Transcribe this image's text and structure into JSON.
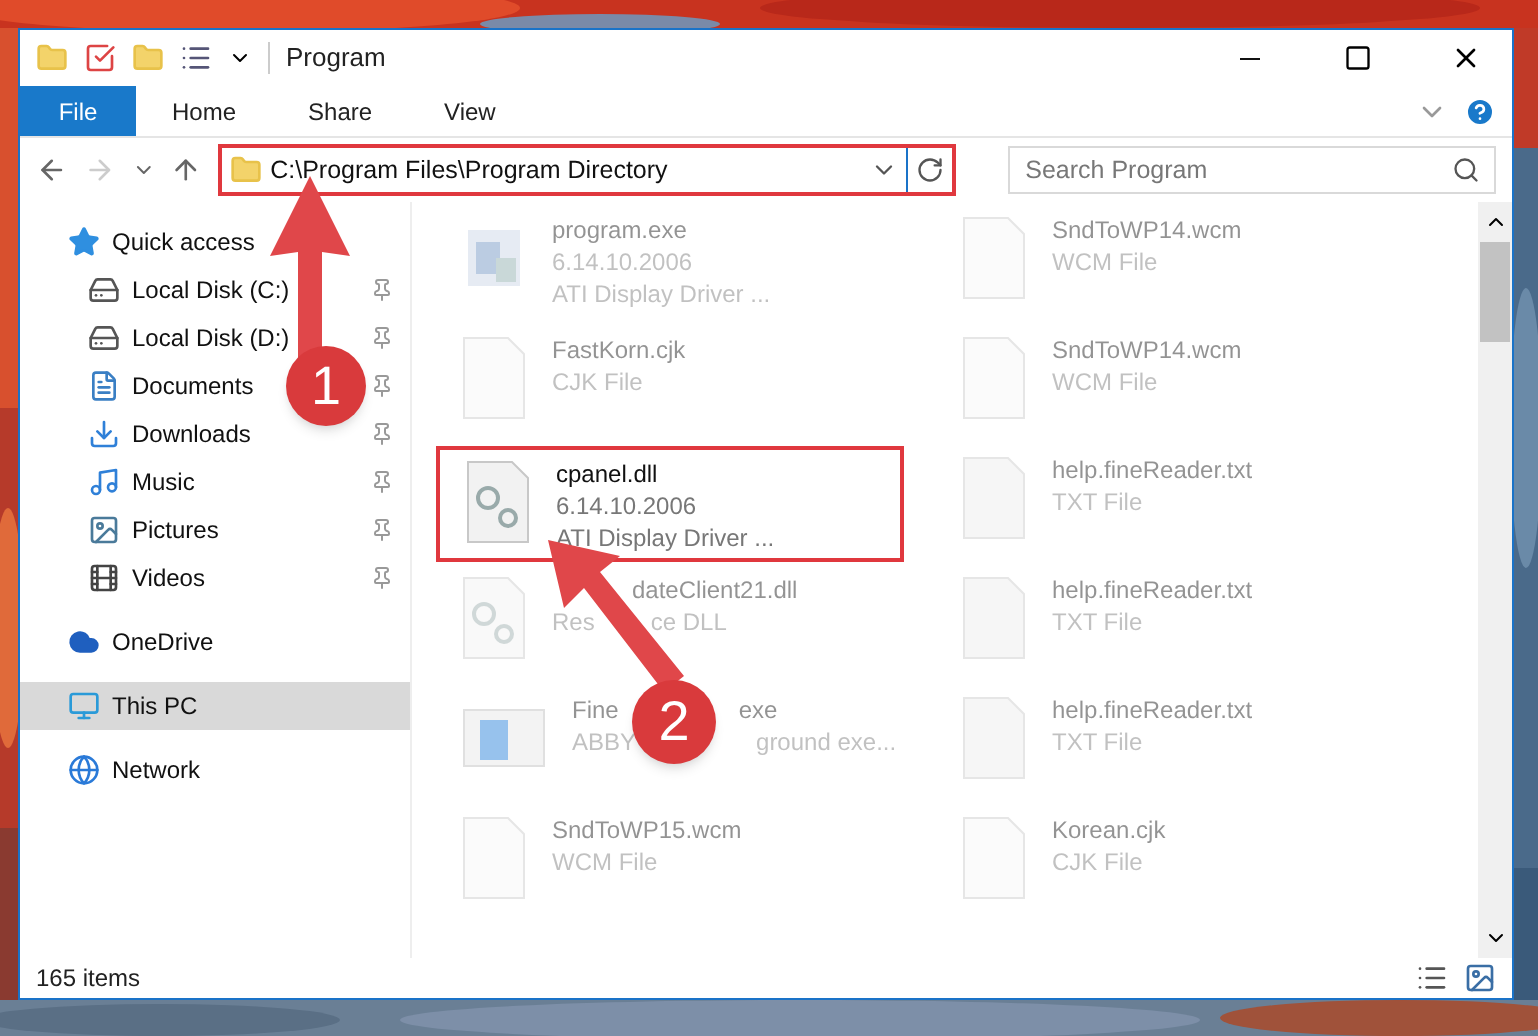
{
  "window": {
    "title": "Program"
  },
  "ribbon_tabs": [
    {
      "label": "File",
      "selected": true
    },
    {
      "label": "Home",
      "selected": false
    },
    {
      "label": "Share",
      "selected": false
    },
    {
      "label": "View",
      "selected": false
    }
  ],
  "address_bar": {
    "path": "C:\\Program Files\\Program Directory",
    "highlighted": true
  },
  "search": {
    "placeholder": "Search Program"
  },
  "sidebar": {
    "items": [
      {
        "label": "Quick access",
        "kind": "star",
        "selected": false,
        "pinned": false,
        "children": [
          {
            "label": "Local Disk (C:)",
            "kind": "disk",
            "selected": false,
            "pinned": true
          },
          {
            "label": "Local Disk (D:)",
            "kind": "disk",
            "selected": false,
            "pinned": true
          },
          {
            "label": "Documents",
            "kind": "doc",
            "selected": false,
            "pinned": true
          },
          {
            "label": "Downloads",
            "kind": "download",
            "selected": false,
            "pinned": true
          },
          {
            "label": "Music",
            "kind": "music",
            "selected": false,
            "pinned": true
          },
          {
            "label": "Pictures",
            "kind": "picture",
            "selected": false,
            "pinned": true
          },
          {
            "label": "Videos",
            "kind": "video",
            "selected": false,
            "pinned": true
          }
        ]
      },
      {
        "label": "OneDrive",
        "kind": "cloud",
        "selected": false,
        "pinned": false
      },
      {
        "label": "This PC",
        "kind": "pc",
        "selected": true,
        "pinned": false
      },
      {
        "label": "Network",
        "kind": "network",
        "selected": false,
        "pinned": false
      }
    ]
  },
  "files": [
    {
      "name": "program.exe",
      "lines": [
        "6.14.10.2006",
        "ATI Display Driver ..."
      ],
      "kind": "exe",
      "highlighted": false
    },
    {
      "name": "SndToWP14.wcm",
      "lines": [
        "WCM File"
      ],
      "kind": "file",
      "highlighted": false
    },
    {
      "name": "FastKorn.cjk",
      "lines": [
        "CJK File"
      ],
      "kind": "file",
      "highlighted": false
    },
    {
      "name": "SndToWP14.wcm",
      "lines": [
        "WCM File"
      ],
      "kind": "file",
      "highlighted": false
    },
    {
      "name": "cpanel.dll",
      "lines": [
        "6.14.10.2006",
        "ATI Display Driver ..."
      ],
      "kind": "dll",
      "highlighted": true
    },
    {
      "name": "help.fineReader.txt",
      "lines": [
        "TXT File"
      ],
      "kind": "txt",
      "highlighted": false
    },
    {
      "name": [
        "dateClient21.dll"
      ],
      "lines": [
        [
          "Res",
          "ce DLL"
        ]
      ],
      "kind": "dll",
      "highlighted": false
    },
    {
      "name": "help.fineReader.txt",
      "lines": [
        "TXT File"
      ],
      "kind": "txt",
      "highlighted": false
    },
    {
      "name": [
        "Fine",
        "exe"
      ],
      "lines": [
        [
          "ABBY",
          "ground exe..."
        ]
      ],
      "kind": "app",
      "highlighted": false
    },
    {
      "name": "help.fineReader.txt",
      "lines": [
        "TXT File"
      ],
      "kind": "txt",
      "highlighted": false
    },
    {
      "name": "SndToWP15.wcm",
      "lines": [
        "WCM File"
      ],
      "kind": "file",
      "highlighted": false
    },
    {
      "name": "Korean.cjk",
      "lines": [
        "CJK File"
      ],
      "kind": "file",
      "highlighted": false
    }
  ],
  "status_bar": {
    "count": "165 items"
  },
  "annotations": [
    {
      "label": "1"
    },
    {
      "label": "2"
    }
  ]
}
